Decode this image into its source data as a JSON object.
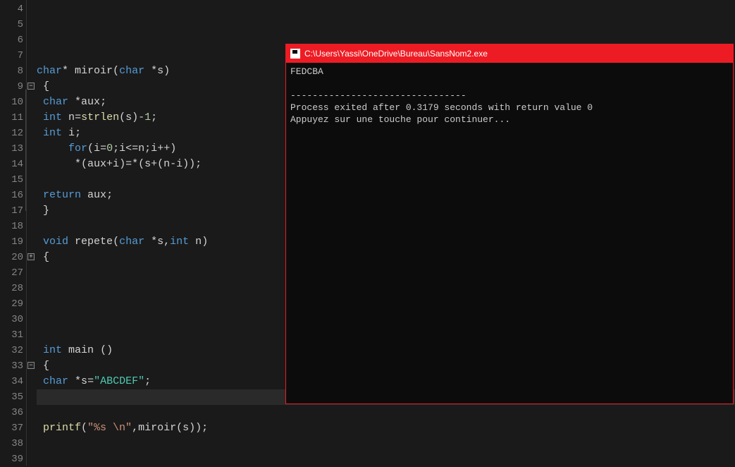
{
  "editor": {
    "lines": [
      {
        "num": 4,
        "fold": null,
        "tokens": []
      },
      {
        "num": 5,
        "fold": null,
        "tokens": []
      },
      {
        "num": 6,
        "fold": null,
        "tokens": []
      },
      {
        "num": 7,
        "fold": null,
        "tokens": []
      },
      {
        "num": 8,
        "fold": null,
        "tokens": [
          [
            "kw",
            "char"
          ],
          [
            "op",
            "* "
          ],
          [
            "id",
            "miroir"
          ],
          [
            "op",
            "("
          ],
          [
            "kw",
            "char"
          ],
          [
            "op",
            " *"
          ],
          [
            "id",
            "s"
          ],
          [
            "op",
            ")"
          ]
        ]
      },
      {
        "num": 9,
        "fold": "-",
        "tokens": [
          [
            "op",
            " {"
          ]
        ]
      },
      {
        "num": 10,
        "fold": null,
        "tokens": [
          [
            "op",
            " "
          ],
          [
            "kw",
            "char"
          ],
          [
            "op",
            " *"
          ],
          [
            "id",
            "aux"
          ],
          [
            "op",
            ";"
          ]
        ]
      },
      {
        "num": 11,
        "fold": null,
        "tokens": [
          [
            "op",
            " "
          ],
          [
            "kw",
            "int"
          ],
          [
            "op",
            " "
          ],
          [
            "id",
            "n"
          ],
          [
            "op",
            "="
          ],
          [
            "fn",
            "strlen"
          ],
          [
            "op",
            "("
          ],
          [
            "id",
            "s"
          ],
          [
            "op",
            ")-"
          ],
          [
            "num",
            "1"
          ],
          [
            "op",
            ";"
          ]
        ]
      },
      {
        "num": 12,
        "fold": null,
        "tokens": [
          [
            "op",
            " "
          ],
          [
            "kw",
            "int"
          ],
          [
            "op",
            " "
          ],
          [
            "id",
            "i"
          ],
          [
            "op",
            ";"
          ]
        ]
      },
      {
        "num": 13,
        "fold": null,
        "tokens": [
          [
            "op",
            "     "
          ],
          [
            "kw",
            "for"
          ],
          [
            "op",
            "("
          ],
          [
            "id",
            "i"
          ],
          [
            "op",
            "="
          ],
          [
            "num",
            "0"
          ],
          [
            "op",
            ";"
          ],
          [
            "id",
            "i"
          ],
          [
            "op",
            "<="
          ],
          [
            "id",
            "n"
          ],
          [
            "op",
            ";"
          ],
          [
            "id",
            "i"
          ],
          [
            "op",
            "++)"
          ]
        ]
      },
      {
        "num": 14,
        "fold": null,
        "tokens": [
          [
            "op",
            "      *("
          ],
          [
            "id",
            "aux"
          ],
          [
            "op",
            "+"
          ],
          [
            "id",
            "i"
          ],
          [
            "op",
            ")=*("
          ],
          [
            "id",
            "s"
          ],
          [
            "op",
            "+("
          ],
          [
            "id",
            "n"
          ],
          [
            "op",
            "-"
          ],
          [
            "id",
            "i"
          ],
          [
            "op",
            "));"
          ]
        ]
      },
      {
        "num": 15,
        "fold": null,
        "tokens": []
      },
      {
        "num": 16,
        "fold": null,
        "tokens": [
          [
            "op",
            " "
          ],
          [
            "kw",
            "return"
          ],
          [
            "op",
            " "
          ],
          [
            "id",
            "aux"
          ],
          [
            "op",
            ";"
          ]
        ]
      },
      {
        "num": 17,
        "fold": null,
        "tokens": [
          [
            "op",
            " }"
          ]
        ]
      },
      {
        "num": 18,
        "fold": null,
        "tokens": []
      },
      {
        "num": 19,
        "fold": null,
        "tokens": [
          [
            "op",
            " "
          ],
          [
            "kw",
            "void"
          ],
          [
            "op",
            " "
          ],
          [
            "id",
            "repete"
          ],
          [
            "op",
            "("
          ],
          [
            "kw",
            "char"
          ],
          [
            "op",
            " *"
          ],
          [
            "id",
            "s"
          ],
          [
            "op",
            ","
          ],
          [
            "kw",
            "int"
          ],
          [
            "op",
            " "
          ],
          [
            "id",
            "n"
          ],
          [
            "op",
            ")"
          ]
        ]
      },
      {
        "num": 20,
        "fold": "+",
        "tokens": [
          [
            "op",
            " {"
          ]
        ]
      },
      {
        "num": 27,
        "fold": null,
        "tokens": []
      },
      {
        "num": 28,
        "fold": null,
        "tokens": []
      },
      {
        "num": 29,
        "fold": null,
        "tokens": []
      },
      {
        "num": 30,
        "fold": null,
        "tokens": []
      },
      {
        "num": 31,
        "fold": null,
        "tokens": []
      },
      {
        "num": 32,
        "fold": null,
        "tokens": [
          [
            "op",
            " "
          ],
          [
            "kw",
            "int"
          ],
          [
            "op",
            " "
          ],
          [
            "id",
            "main"
          ],
          [
            "op",
            " ()"
          ]
        ]
      },
      {
        "num": 33,
        "fold": "-",
        "tokens": [
          [
            "op",
            " {"
          ]
        ]
      },
      {
        "num": 34,
        "fold": null,
        "tokens": [
          [
            "op",
            " "
          ],
          [
            "kw",
            "char"
          ],
          [
            "op",
            " *"
          ],
          [
            "id",
            "s"
          ],
          [
            "op",
            "="
          ],
          [
            "str1",
            "\"ABCDEF\""
          ],
          [
            "op",
            ";"
          ]
        ]
      },
      {
        "num": 35,
        "fold": null,
        "current": true,
        "tokens": []
      },
      {
        "num": 36,
        "fold": null,
        "tokens": []
      },
      {
        "num": 37,
        "fold": null,
        "tokens": [
          [
            "op",
            " "
          ],
          [
            "fn",
            "printf"
          ],
          [
            "op",
            "("
          ],
          [
            "str2",
            "\"%s \\n\""
          ],
          [
            "op",
            ","
          ],
          [
            "id",
            "miroir"
          ],
          [
            "op",
            "("
          ],
          [
            "id",
            "s"
          ],
          [
            "op",
            "));"
          ]
        ]
      },
      {
        "num": 38,
        "fold": null,
        "tokens": []
      },
      {
        "num": 39,
        "fold": null,
        "tokens": []
      }
    ]
  },
  "console": {
    "title": "C:\\Users\\Yassi\\OneDrive\\Bureau\\SansNom2.exe",
    "output_line1": "FEDCBA",
    "sep": "--------------------------------",
    "output_line2": "Process exited after 0.3179 seconds with return value 0",
    "output_line3": "Appuyez sur une touche pour continuer..."
  }
}
